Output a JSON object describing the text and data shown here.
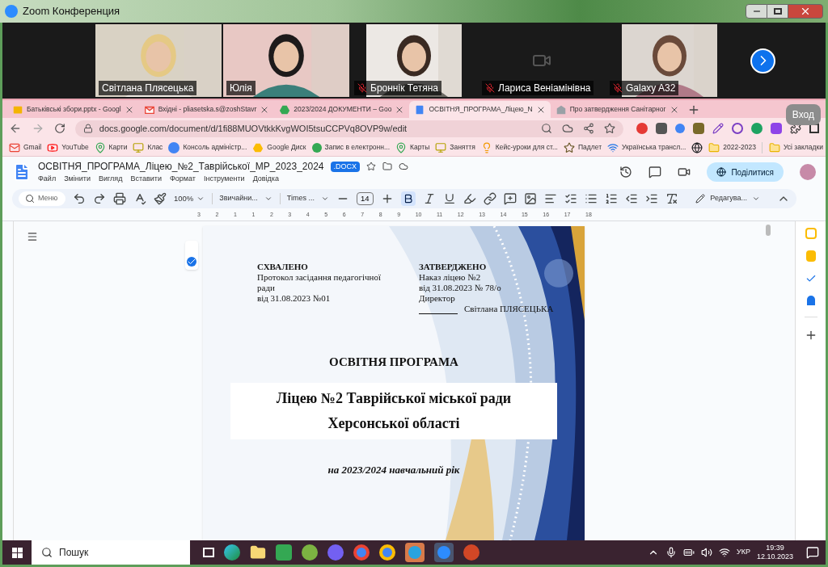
{
  "zoom_window": {
    "title": "Zoom Конференция"
  },
  "participants": [
    {
      "name": "Світлана Плясецька",
      "muted": false,
      "kind": "video"
    },
    {
      "name": "Юлія",
      "muted": false,
      "kind": "video"
    },
    {
      "name": "Броннік Тетяна",
      "muted": true,
      "kind": "video"
    },
    {
      "name": "Лариса Веніамінівна",
      "muted": true,
      "kind": "off"
    },
    {
      "name": "Galaxy A32",
      "muted": true,
      "kind": "video"
    }
  ],
  "browser": {
    "tabs": [
      {
        "label": "Батьківські збори.pptx - Googl",
        "kind": "slides",
        "selected": false
      },
      {
        "label": "Вхідні - pliasetska.s@zoshStavr",
        "kind": "mail",
        "selected": false
      },
      {
        "label": "2023/2024 ДОКУМЕНТИ – Goo",
        "kind": "drive",
        "selected": false
      },
      {
        "label": "ОСВІТНЯ_ПРОГРАМА_Ліцею_N",
        "kind": "docs",
        "selected": true
      },
      {
        "label": "Про затвердження Санітарног",
        "kind": "page",
        "selected": false
      }
    ],
    "profile_badge": "Вход",
    "url": "docs.google.com/document/d/1fi88MUOVtkkKvgWOI5tsuCCPVq8OVP9w/edit",
    "bookmarks": [
      {
        "label": "Gmail",
        "kind": "mail"
      },
      {
        "label": "YouTube",
        "kind": "video"
      },
      {
        "label": "Карти",
        "kind": "map"
      },
      {
        "label": "Клас",
        "kind": "class"
      },
      {
        "label": "Консоль адміністр...",
        "kind": "g"
      },
      {
        "label": "Google Диск",
        "kind": "drive"
      },
      {
        "label": "Запис в електронн...",
        "kind": "dot"
      },
      {
        "label": "Карты",
        "kind": "map"
      },
      {
        "label": "Заняття",
        "kind": "class"
      },
      {
        "label": "Кейс-уроки для ст...",
        "kind": "bulb"
      },
      {
        "label": "Падлет",
        "kind": "padlet"
      },
      {
        "label": "Українська трансл...",
        "kind": "wave"
      },
      {
        "kind": "globe"
      },
      {
        "label": "2022-2023",
        "kind": "folder"
      }
    ],
    "all_bookmarks": "Усі закладки"
  },
  "doc": {
    "title": "ОСВІТНЯ_ПРОГРАМА_Ліцею_№2_Таврійської_МР_2023_2024",
    "format_badge": ".DOCX",
    "menu": [
      "Файл",
      "Змінити",
      "Вигляд",
      "Вставити",
      "Формат",
      "Інструменти",
      "Довідка"
    ],
    "share": "Поділитися",
    "toolbar": {
      "menu_search": "Меню",
      "zoom": "100%",
      "style": "Звичайни...",
      "font": "Times ...",
      "size": "14",
      "mode": "Редагува..."
    },
    "ruler": [
      "3",
      "2",
      "1",
      "1",
      "2",
      "3",
      "4",
      "5",
      "6",
      "7",
      "8",
      "9",
      "10",
      "11",
      "12",
      "13",
      "14",
      "15",
      "16",
      "17",
      "18"
    ],
    "page": {
      "left_block": {
        "heading": "СХВАЛЕНО",
        "lines": [
          "Протокол засідання педагогічної ради",
          "від 31.08.2023 №01"
        ]
      },
      "right_block": {
        "heading": "ЗАТВЕРДЖЕНО",
        "lines": [
          "Наказ ліцею №2",
          "від 31.08.2023 № 78/о",
          "Директор"
        ],
        "signature": "Світлана ПЛЯСЕЦЬКА"
      },
      "title": "ОСВІТНЯ ПРОГРАМА",
      "subtitle": [
        "Ліцею №2 Таврійської міської ради",
        "Херсонської області"
      ],
      "year": "на 2023/2024 навчальний рік"
    }
  },
  "taskbar": {
    "search": "Пошук",
    "language": "УКР",
    "time": "19:39",
    "date": "12.10.2023"
  }
}
